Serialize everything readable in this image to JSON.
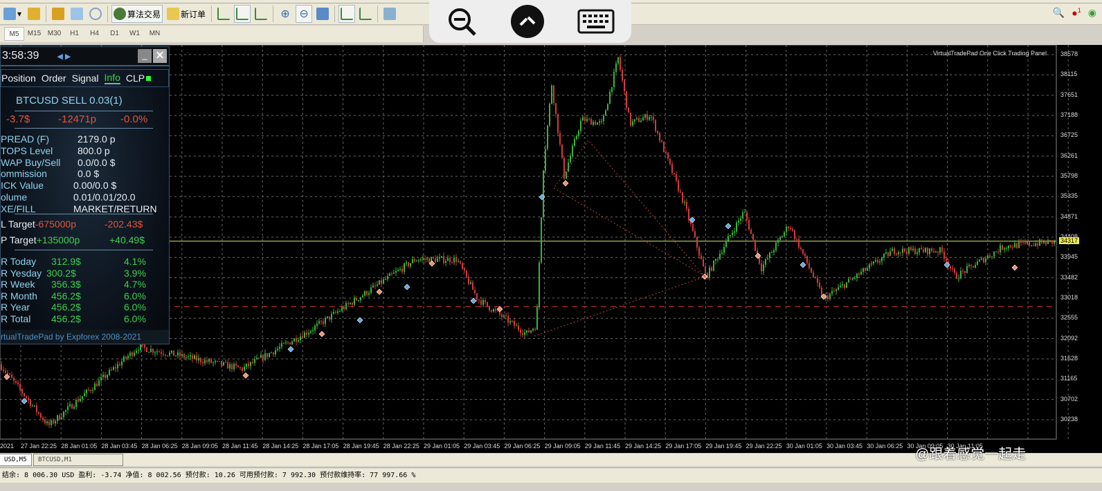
{
  "toolbar": {
    "algo_trading": "算法交易",
    "new_order": "新订单"
  },
  "timeframes": [
    "M5",
    "M15",
    "M30",
    "H1",
    "H4",
    "D1",
    "W1",
    "MN"
  ],
  "notification_count": "1",
  "panel": {
    "time": "3:58:39",
    "tabs": [
      "Position",
      "Order",
      "Signal",
      "Info",
      "CLP"
    ],
    "symbol_line": "BTCUSD SELL 0.03(1)",
    "pl": {
      "money": "-3.7$",
      "points": "-12471p",
      "percent": "-0.0%"
    },
    "info": [
      [
        "PREAD (F)",
        "2179.0 p"
      ],
      [
        "TOPS Level",
        "800.0 p"
      ],
      [
        "WAP Buy/Sell",
        "0.0/0.0 $"
      ],
      [
        "ommission",
        "0.0 $"
      ],
      [
        "ICK Value",
        "0.00/0.0 $"
      ],
      [
        "olume",
        "0.01/0.01/20.0"
      ],
      [
        "XE/FILL",
        "MARKET/RETURN"
      ]
    ],
    "sl": {
      "label": "L Target",
      "points": "-675000p",
      "money": "-202.43$"
    },
    "tp": {
      "label": "P Target",
      "points": "+135000p",
      "money": "+40.49$"
    },
    "stats": [
      [
        "R Today",
        "312.9$",
        "4.1%"
      ],
      [
        "R Yesday",
        "300.2$",
        "3.9%"
      ],
      [
        "R Week",
        "356.3$",
        "4.7%"
      ],
      [
        "R Month",
        "456.2$",
        "6.0%"
      ],
      [
        "R Year",
        "456.2$",
        "6.0%"
      ],
      [
        "R Total",
        "456.2$",
        "6.0%"
      ]
    ],
    "footer": "rtualTradePad by Expforex 2008-2021"
  },
  "chart": {
    "panel_label": "VirtualTradePad One Click Trading Panel",
    "current_price": "34317",
    "y_ticks": [
      "38578",
      "38115",
      "37651",
      "37188",
      "36725",
      "36261",
      "35798",
      "35335",
      "34871",
      "34408",
      "33945",
      "33482",
      "33018",
      "32555",
      "32092",
      "31628",
      "31165",
      "30702",
      "30238"
    ],
    "x_ticks": [
      "2021",
      "27 Jan 22:25",
      "28 Jan 01:05",
      "28 Jan 03:45",
      "28 Jan 06:25",
      "28 Jan 09:05",
      "28 Jan 11:45",
      "28 Jan 14:25",
      "28 Jan 17:05",
      "28 Jan 19:45",
      "28 Jan 22:25",
      "29 Jan 01:05",
      "29 Jan 03:45",
      "29 Jan 06:25",
      "29 Jan 09:05",
      "29 Jan 11:45",
      "29 Jan 14:25",
      "29 Jan 17:05",
      "29 Jan 19:45",
      "29 Jan 22:25",
      "30 Jan 01:05",
      "30 Jan 03:45",
      "30 Jan 06:25",
      "30 Jan 09:05",
      "30 Jan 11:05"
    ],
    "y_range": [
      30238,
      38578
    ],
    "price_path": [
      [
        0,
        31500
      ],
      [
        70,
        30100
      ],
      [
        200,
        31900
      ],
      [
        350,
        31400
      ],
      [
        450,
        32300
      ],
      [
        600,
        33900
      ],
      [
        660,
        33900
      ],
      [
        690,
        33000
      ],
      [
        760,
        32200
      ],
      [
        775,
        32400
      ],
      [
        785,
        36000
      ],
      [
        797,
        37900
      ],
      [
        815,
        35800
      ],
      [
        840,
        37100
      ],
      [
        870,
        37000
      ],
      [
        893,
        38500
      ],
      [
        910,
        37000
      ],
      [
        940,
        37200
      ],
      [
        990,
        35100
      ],
      [
        1020,
        33500
      ],
      [
        1075,
        35000
      ],
      [
        1100,
        33700
      ],
      [
        1140,
        34700
      ],
      [
        1190,
        33000
      ],
      [
        1290,
        34100
      ],
      [
        1360,
        34100
      ],
      [
        1380,
        33500
      ],
      [
        1450,
        34200
      ],
      [
        1520,
        34300
      ]
    ],
    "dashed_red_level": 32820,
    "colors": {
      "bull": "#3cb43c",
      "bear": "#d23c3c",
      "grid": "#6a6a6a",
      "price_line": "#d8f060"
    }
  },
  "bottom_tabs": [
    "USD,M5",
    "BTCUSD,M1"
  ],
  "status": "结余: 8 006.30 USD  盈利: -3.74  净值: 8 002.56  预付款: 10.26  可用预付款: 7 992.30  预付款维持率: 77 997.66 %",
  "watermark": "@跟着感觉一起走"
}
